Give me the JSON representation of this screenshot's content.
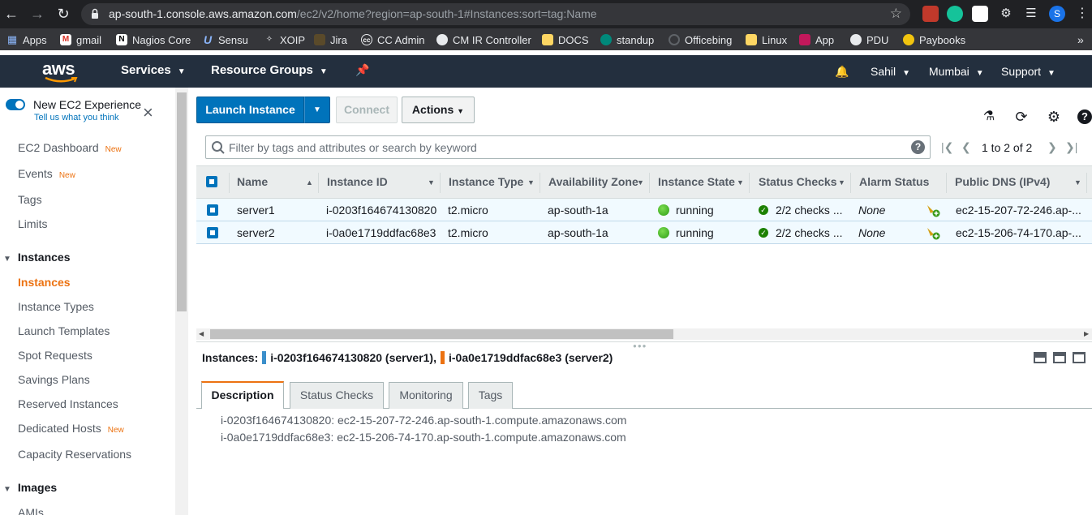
{
  "browser": {
    "url_host": "ap-south-1.console.aws.amazon.com",
    "url_path": "/ec2/v2/home?region=ap-south-1#Instances:sort=tag:Name",
    "profile_initial": "S"
  },
  "bookmarks": [
    {
      "label": "Apps",
      "icon": "apps-grid-icon"
    },
    {
      "label": "gmail",
      "icon": "gmail-icon"
    },
    {
      "label": "Nagios Core",
      "icon": "nagios-icon"
    },
    {
      "label": "Sensu",
      "icon": "sensu-icon"
    },
    {
      "label": "XOIP",
      "icon": "folder-icon"
    },
    {
      "label": "Jira",
      "icon": "jira-icon"
    },
    {
      "label": "CC Admin",
      "icon": "cc-icon"
    },
    {
      "label": "CM IR Controller",
      "icon": "globe-icon"
    },
    {
      "label": "DOCS",
      "icon": "folder-icon"
    },
    {
      "label": "standup",
      "icon": "meet-icon"
    },
    {
      "label": "Officebing",
      "icon": "office-icon"
    },
    {
      "label": "Linux",
      "icon": "folder-icon"
    },
    {
      "label": "App",
      "icon": "app-icon"
    },
    {
      "label": "PDU",
      "icon": "globe-icon"
    },
    {
      "label": "Paybooks",
      "icon": "paybooks-icon"
    }
  ],
  "awsnav": {
    "logo": "aws",
    "services": "Services",
    "resource_groups": "Resource Groups",
    "user": "Sahil",
    "region": "Mumbai",
    "support": "Support"
  },
  "sidebar": {
    "new_experience": "New EC2 Experience",
    "tell_us": "Tell us what you think",
    "new_tag": "New",
    "items": {
      "dashboard": "EC2 Dashboard",
      "events": "Events",
      "tags": "Tags",
      "limits": "Limits",
      "instances_section": "Instances",
      "instances": "Instances",
      "instance_types": "Instance Types",
      "launch_templates": "Launch Templates",
      "spot_requests": "Spot Requests",
      "savings_plans": "Savings Plans",
      "reserved_instances": "Reserved Instances",
      "dedicated_hosts": "Dedicated Hosts",
      "capacity_reservations": "Capacity Reservations",
      "images_section": "Images",
      "amis": "AMIs"
    }
  },
  "toolbar": {
    "launch": "Launch Instance",
    "connect": "Connect",
    "actions": "Actions"
  },
  "filter": {
    "placeholder": "Filter by tags and attributes or search by keyword"
  },
  "pager": {
    "text": "1 to 2 of 2"
  },
  "table": {
    "columns": [
      "Name",
      "Instance ID",
      "Instance Type",
      "Availability Zone",
      "Instance State",
      "Status Checks",
      "Alarm Status",
      "Public DNS (IPv4)"
    ],
    "rows": [
      {
        "name": "server1",
        "id": "i-0203f164674130820",
        "type": "t2.micro",
        "az": "ap-south-1a",
        "state": "running",
        "checks": "2/2 checks ...",
        "alarm": "None",
        "dns": "ec2-15-207-72-246.ap-..."
      },
      {
        "name": "server2",
        "id": "i-0a0e1719ddfac68e3",
        "type": "t2.micro",
        "az": "ap-south-1a",
        "state": "running",
        "checks": "2/2 checks ...",
        "alarm": "None",
        "dns": "ec2-15-206-74-170.ap-..."
      }
    ]
  },
  "selection": {
    "label": "Instances:",
    "first": "i-0203f164674130820 (server1),",
    "second": "i-0a0e1719ddfac68e3 (server2)",
    "first_color": "#3b8fcb",
    "second_color": "#ec7211"
  },
  "detail_tabs": [
    "Description",
    "Status Checks",
    "Monitoring",
    "Tags"
  ],
  "description": [
    "i-0203f164674130820: ec2-15-207-72-246.ap-south-1.compute.amazonaws.com",
    "i-0a0e1719ddfac68e3: ec2-15-206-74-170.ap-south-1.compute.amazonaws.com"
  ],
  "colors": {
    "aws_nav": "#232f3e",
    "primary": "#0073bb",
    "accent": "#ec7211"
  }
}
